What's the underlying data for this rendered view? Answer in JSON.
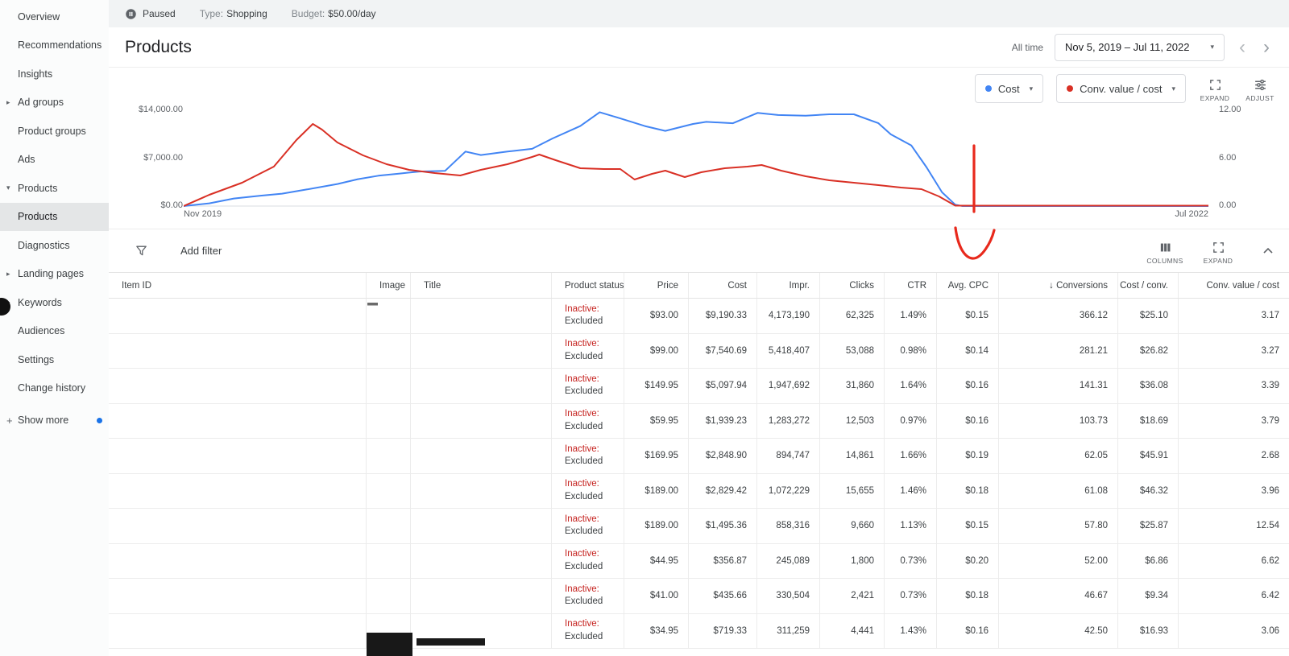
{
  "topbar": {
    "status": "Paused",
    "type_label": "Type:",
    "type_value": "Shopping",
    "budget_label": "Budget:",
    "budget_value": "$50.00/day"
  },
  "sidebar": {
    "items": [
      {
        "label": "Overview"
      },
      {
        "label": "Recommendations"
      },
      {
        "label": "Insights"
      },
      {
        "label": "Ad groups",
        "arrow": "right"
      },
      {
        "label": "Product groups"
      },
      {
        "label": "Ads"
      },
      {
        "label": "Products",
        "arrow": "down"
      },
      {
        "label": "Products",
        "sub": true,
        "selected": true
      },
      {
        "label": "Diagnostics",
        "sub": true
      },
      {
        "label": "Landing pages",
        "arrow": "right"
      },
      {
        "label": "Keywords",
        "arrow": "right"
      },
      {
        "label": "Audiences"
      },
      {
        "label": "Settings"
      },
      {
        "label": "Change history"
      }
    ],
    "show_more": "Show more"
  },
  "header": {
    "title": "Products",
    "date_preset": "All time",
    "date_range": "Nov 5, 2019 – Jul 11, 2022"
  },
  "chart": {
    "series_buttons": [
      {
        "label": "Cost"
      },
      {
        "label": "Conv. value / cost"
      }
    ],
    "expand_label": "EXPAND",
    "adjust_label": "ADJUST"
  },
  "chart_data": {
    "type": "line",
    "title": "Products performance over time",
    "x_axis": {
      "start_label": "Nov 2019",
      "end_label": "Jul 2022"
    },
    "left_axis": {
      "ticks": [
        "$0.00",
        "$7,000.00",
        "$14,000.00"
      ],
      "range": [
        0,
        14000
      ]
    },
    "right_axis": {
      "ticks": [
        "0.00",
        "6.00",
        "12.00"
      ],
      "range": [
        0,
        12
      ]
    },
    "legend_position": "top-right",
    "grid": false,
    "series": [
      {
        "name": "Cost",
        "axis": "left",
        "color": "#4285f4",
        "points": [
          [
            0,
            0
          ],
          [
            2.5,
            400
          ],
          [
            4.9,
            1100
          ],
          [
            7.5,
            1500
          ],
          [
            9.6,
            1800
          ],
          [
            12,
            2400
          ],
          [
            15,
            3200
          ],
          [
            17,
            3900
          ],
          [
            19,
            4400
          ],
          [
            21,
            4700
          ],
          [
            23,
            5000
          ],
          [
            25.5,
            5100
          ],
          [
            27.5,
            7900
          ],
          [
            29,
            7400
          ],
          [
            31.6,
            7900
          ],
          [
            34,
            8300
          ],
          [
            36,
            9800
          ],
          [
            38.7,
            11600
          ],
          [
            40.6,
            13600
          ],
          [
            42.6,
            12700
          ],
          [
            45,
            11600
          ],
          [
            47,
            10900
          ],
          [
            49.7,
            11900
          ],
          [
            51,
            12200
          ],
          [
            53.6,
            12000
          ],
          [
            56,
            13500
          ],
          [
            58,
            13200
          ],
          [
            60.7,
            13100
          ],
          [
            63,
            13300
          ],
          [
            65.4,
            13300
          ],
          [
            67.8,
            12000
          ],
          [
            69,
            10400
          ],
          [
            71,
            8800
          ],
          [
            72.5,
            5600
          ],
          [
            74,
            2000
          ],
          [
            75.3,
            200
          ],
          [
            76,
            0
          ],
          [
            100,
            0
          ]
        ]
      },
      {
        "name": "Conv. value / cost",
        "axis": "right",
        "color": "#d93025",
        "points": [
          [
            0,
            0
          ],
          [
            2.5,
            1.4
          ],
          [
            5.7,
            2.9
          ],
          [
            8.8,
            4.9
          ],
          [
            11,
            8.2
          ],
          [
            12.6,
            10.2
          ],
          [
            13.5,
            9.5
          ],
          [
            15,
            7.9
          ],
          [
            17.5,
            6.3
          ],
          [
            19.8,
            5.2
          ],
          [
            22,
            4.5
          ],
          [
            24.5,
            4.1
          ],
          [
            27,
            3.8
          ],
          [
            29,
            4.5
          ],
          [
            31.6,
            5.2
          ],
          [
            34,
            6.1
          ],
          [
            34.7,
            6.4
          ],
          [
            36.3,
            5.7
          ],
          [
            38.7,
            4.7
          ],
          [
            41,
            4.6
          ],
          [
            42.6,
            4.6
          ],
          [
            44,
            3.3
          ],
          [
            45.7,
            4
          ],
          [
            47,
            4.4
          ],
          [
            48.9,
            3.6
          ],
          [
            50.5,
            4.2
          ],
          [
            52.8,
            4.7
          ],
          [
            55,
            4.9
          ],
          [
            56.4,
            5.1
          ],
          [
            58.3,
            4.4
          ],
          [
            60.7,
            3.7
          ],
          [
            63,
            3.2
          ],
          [
            65.4,
            2.9
          ],
          [
            67.8,
            2.6
          ],
          [
            70,
            2.3
          ],
          [
            72,
            2.1
          ],
          [
            73.7,
            1.2
          ],
          [
            75.3,
            0.05
          ],
          [
            100,
            0.05
          ]
        ]
      }
    ]
  },
  "annotation": {
    "shape": "hand-drawn-arrow-down",
    "color": "#e8291c"
  },
  "filter_bar": {
    "add_filter_label": "Add filter",
    "columns_label": "COLUMNS",
    "expand_label": "EXPAND"
  },
  "table": {
    "columns": [
      {
        "label": "Item ID",
        "align": "left"
      },
      {
        "label": "Image",
        "align": "left"
      },
      {
        "label": "Title",
        "align": "left"
      },
      {
        "label": "Product status",
        "align": "left"
      },
      {
        "label": "Price",
        "align": "right"
      },
      {
        "label": "Cost",
        "align": "right"
      },
      {
        "label": "Impr.",
        "align": "right"
      },
      {
        "label": "Clicks",
        "align": "right"
      },
      {
        "label": "CTR",
        "align": "right"
      },
      {
        "label": "Avg. CPC",
        "align": "right"
      },
      {
        "label": "Conversions",
        "align": "right",
        "sorted": "desc"
      },
      {
        "label": "Cost / conv.",
        "align": "right"
      },
      {
        "label": "Conv. value / cost",
        "align": "right"
      }
    ],
    "rows": [
      {
        "status_1": "Inactive:",
        "status_2": "Excluded",
        "price": "$93.00",
        "cost": "$9,190.33",
        "impr": "4,173,190",
        "clicks": "62,325",
        "ctr": "1.49%",
        "avg_cpc": "$0.15",
        "conversions": "366.12",
        "cost_per_conv": "$25.10",
        "conv_value_per_cost": "3.17"
      },
      {
        "status_1": "Inactive:",
        "status_2": "Excluded",
        "price": "$99.00",
        "cost": "$7,540.69",
        "impr": "5,418,407",
        "clicks": "53,088",
        "ctr": "0.98%",
        "avg_cpc": "$0.14",
        "conversions": "281.21",
        "cost_per_conv": "$26.82",
        "conv_value_per_cost": "3.27"
      },
      {
        "status_1": "Inactive:",
        "status_2": "Excluded",
        "price": "$149.95",
        "cost": "$5,097.94",
        "impr": "1,947,692",
        "clicks": "31,860",
        "ctr": "1.64%",
        "avg_cpc": "$0.16",
        "conversions": "141.31",
        "cost_per_conv": "$36.08",
        "conv_value_per_cost": "3.39"
      },
      {
        "status_1": "Inactive:",
        "status_2": "Excluded",
        "price": "$59.95",
        "cost": "$1,939.23",
        "impr": "1,283,272",
        "clicks": "12,503",
        "ctr": "0.97%",
        "avg_cpc": "$0.16",
        "conversions": "103.73",
        "cost_per_conv": "$18.69",
        "conv_value_per_cost": "3.79"
      },
      {
        "status_1": "Inactive:",
        "status_2": "Excluded",
        "price": "$169.95",
        "cost": "$2,848.90",
        "impr": "894,747",
        "clicks": "14,861",
        "ctr": "1.66%",
        "avg_cpc": "$0.19",
        "conversions": "62.05",
        "cost_per_conv": "$45.91",
        "conv_value_per_cost": "2.68"
      },
      {
        "status_1": "Inactive:",
        "status_2": "Excluded",
        "price": "$189.00",
        "cost": "$2,829.42",
        "impr": "1,072,229",
        "clicks": "15,655",
        "ctr": "1.46%",
        "avg_cpc": "$0.18",
        "conversions": "61.08",
        "cost_per_conv": "$46.32",
        "conv_value_per_cost": "3.96"
      },
      {
        "status_1": "Inactive:",
        "status_2": "Excluded",
        "price": "$189.00",
        "cost": "$1,495.36",
        "impr": "858,316",
        "clicks": "9,660",
        "ctr": "1.13%",
        "avg_cpc": "$0.15",
        "conversions": "57.80",
        "cost_per_conv": "$25.87",
        "conv_value_per_cost": "12.54"
      },
      {
        "status_1": "Inactive:",
        "status_2": "Excluded",
        "price": "$44.95",
        "cost": "$356.87",
        "impr": "245,089",
        "clicks": "1,800",
        "ctr": "0.73%",
        "avg_cpc": "$0.20",
        "conversions": "52.00",
        "cost_per_conv": "$6.86",
        "conv_value_per_cost": "6.62"
      },
      {
        "status_1": "Inactive:",
        "status_2": "Excluded",
        "price": "$41.00",
        "cost": "$435.66",
        "impr": "330,504",
        "clicks": "2,421",
        "ctr": "0.73%",
        "avg_cpc": "$0.18",
        "conversions": "46.67",
        "cost_per_conv": "$9.34",
        "conv_value_per_cost": "6.42"
      },
      {
        "status_1": "Inactive:",
        "status_2": "Excluded",
        "price": "$34.95",
        "cost": "$719.33",
        "impr": "311,259",
        "clicks": "4,441",
        "ctr": "1.43%",
        "avg_cpc": "$0.16",
        "conversions": "42.50",
        "cost_per_conv": "$16.93",
        "conv_value_per_cost": "3.06"
      }
    ]
  }
}
